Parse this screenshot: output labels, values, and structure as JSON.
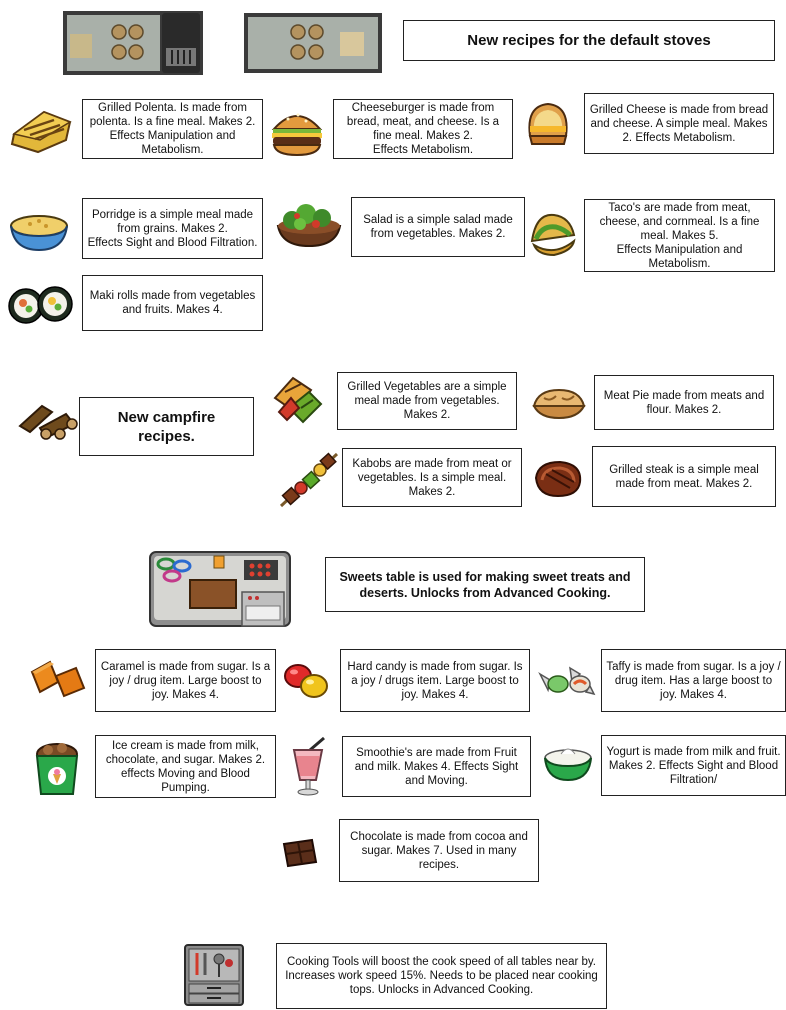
{
  "sections": {
    "default_stoves": {
      "heading": "New recipes for the default stoves",
      "recipes": [
        {
          "icon": "grilled-polenta-icon",
          "text": "Grilled Polenta. Is made from polenta. Is a fine meal. Makes 2.\nEffects Manipulation and Metabolism."
        },
        {
          "icon": "cheeseburger-icon",
          "text": "Cheeseburger is made from bread, meat, and cheese. Is a fine meal. Makes 2.\nEffects Metabolism."
        },
        {
          "icon": "grilled-cheese-icon",
          "text": "Grilled Cheese is made from bread and cheese. A simple meal. Makes 2. Effects Metabolism."
        },
        {
          "icon": "porridge-icon",
          "text": "Porridge is a simple meal made from grains. Makes 2.\nEffects Sight and Blood Filtration."
        },
        {
          "icon": "salad-icon",
          "text": "Salad is a simple salad made from vegetables. Makes 2."
        },
        {
          "icon": "taco-icon",
          "text": "Taco's are made from meat, cheese, and cornmeal. Is a fine meal. Makes 5.\nEffects Manipulation and Metabolism."
        },
        {
          "icon": "maki-rolls-icon",
          "text": "Maki rolls made from vegetables and fruits. Makes 4."
        }
      ]
    },
    "campfire": {
      "heading": "New campfire recipes.",
      "recipes": [
        {
          "icon": "grilled-vegetables-icon",
          "text": "Grilled Vegetables are a simple meal made from vegetables. Makes 2."
        },
        {
          "icon": "meat-pie-icon",
          "text": "Meat Pie made from meats and flour. Makes 2."
        },
        {
          "icon": "kabobs-icon",
          "text": "Kabobs are made from meat or vegetables. Is a simple meal. Makes 2."
        },
        {
          "icon": "grilled-steak-icon",
          "text": "Grilled steak is a simple meal made from meat. Makes 2."
        }
      ]
    },
    "sweets": {
      "heading": "Sweets table is used for making sweet treats and deserts. Unlocks from Advanced Cooking.",
      "recipes": [
        {
          "icon": "caramel-icon",
          "text": "Caramel is made from sugar. Is a joy / drug item. Large boost to joy. Makes 4."
        },
        {
          "icon": "hard-candy-icon",
          "text": "Hard candy is made from sugar. Is a  joy / drugs item. Large boost to joy. Makes 4."
        },
        {
          "icon": "taffy-icon",
          "text": "Taffy is made from sugar. Is a joy / drug item. Has a large boost to joy. Makes 4."
        },
        {
          "icon": "ice-cream-icon",
          "text": "Ice cream is made from milk, chocolate, and sugar. Makes 2. effects Moving and Blood Pumping."
        },
        {
          "icon": "smoothie-icon",
          "text": "Smoothie's are made from Fruit and milk. Makes 4. Effects Sight and Moving."
        },
        {
          "icon": "yogurt-icon",
          "text": "Yogurt is made from milk and fruit. Makes 2. Effects Sight and Blood Filtration/"
        },
        {
          "icon": "chocolate-icon",
          "text": "Chocolate is made from cocoa and sugar. Makes 7.  Used in many recipes."
        }
      ]
    },
    "tools": {
      "text": "Cooking Tools will boost the cook speed of all tables near by. Increases work speed 15%. Needs to be placed near cooking tops. Unlocks in Advanced Cooking."
    }
  }
}
